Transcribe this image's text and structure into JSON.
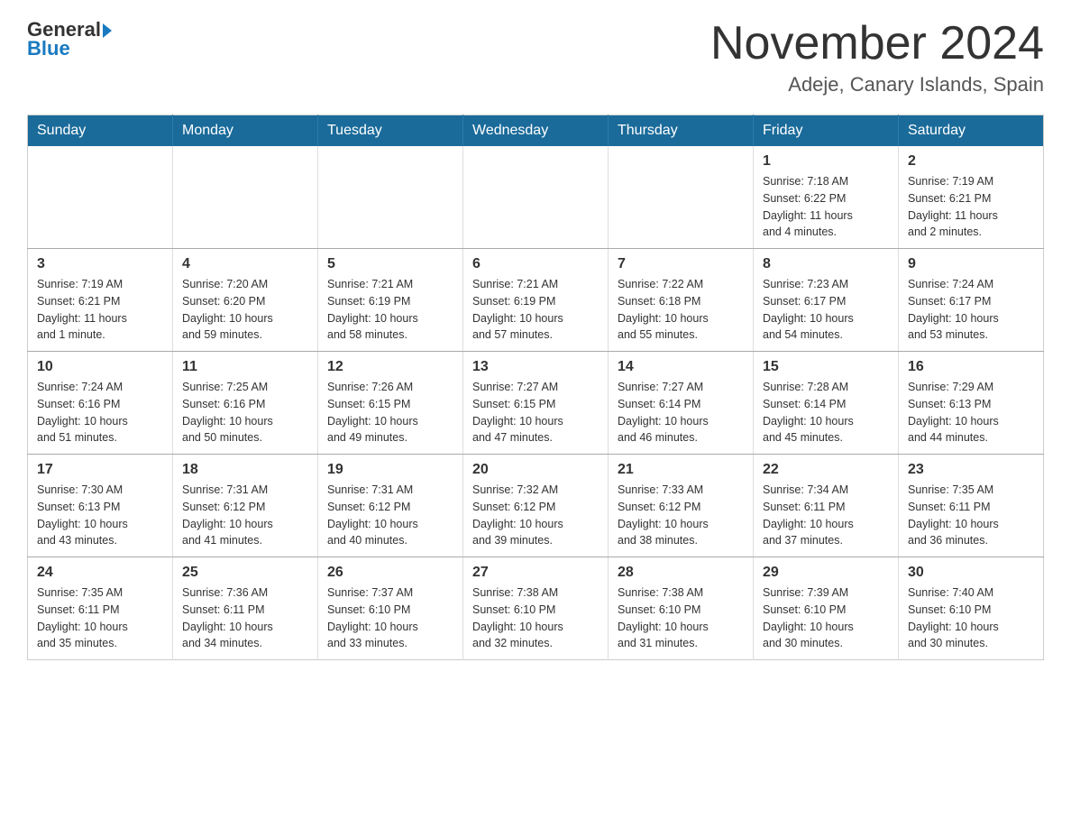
{
  "header": {
    "logo_text_general": "General",
    "logo_text_blue": "Blue",
    "month_title": "November 2024",
    "location": "Adeje, Canary Islands, Spain"
  },
  "weekdays": [
    "Sunday",
    "Monday",
    "Tuesday",
    "Wednesday",
    "Thursday",
    "Friday",
    "Saturday"
  ],
  "weeks": [
    [
      {
        "day": "",
        "info": ""
      },
      {
        "day": "",
        "info": ""
      },
      {
        "day": "",
        "info": ""
      },
      {
        "day": "",
        "info": ""
      },
      {
        "day": "",
        "info": ""
      },
      {
        "day": "1",
        "info": "Sunrise: 7:18 AM\nSunset: 6:22 PM\nDaylight: 11 hours\nand 4 minutes."
      },
      {
        "day": "2",
        "info": "Sunrise: 7:19 AM\nSunset: 6:21 PM\nDaylight: 11 hours\nand 2 minutes."
      }
    ],
    [
      {
        "day": "3",
        "info": "Sunrise: 7:19 AM\nSunset: 6:21 PM\nDaylight: 11 hours\nand 1 minute."
      },
      {
        "day": "4",
        "info": "Sunrise: 7:20 AM\nSunset: 6:20 PM\nDaylight: 10 hours\nand 59 minutes."
      },
      {
        "day": "5",
        "info": "Sunrise: 7:21 AM\nSunset: 6:19 PM\nDaylight: 10 hours\nand 58 minutes."
      },
      {
        "day": "6",
        "info": "Sunrise: 7:21 AM\nSunset: 6:19 PM\nDaylight: 10 hours\nand 57 minutes."
      },
      {
        "day": "7",
        "info": "Sunrise: 7:22 AM\nSunset: 6:18 PM\nDaylight: 10 hours\nand 55 minutes."
      },
      {
        "day": "8",
        "info": "Sunrise: 7:23 AM\nSunset: 6:17 PM\nDaylight: 10 hours\nand 54 minutes."
      },
      {
        "day": "9",
        "info": "Sunrise: 7:24 AM\nSunset: 6:17 PM\nDaylight: 10 hours\nand 53 minutes."
      }
    ],
    [
      {
        "day": "10",
        "info": "Sunrise: 7:24 AM\nSunset: 6:16 PM\nDaylight: 10 hours\nand 51 minutes."
      },
      {
        "day": "11",
        "info": "Sunrise: 7:25 AM\nSunset: 6:16 PM\nDaylight: 10 hours\nand 50 minutes."
      },
      {
        "day": "12",
        "info": "Sunrise: 7:26 AM\nSunset: 6:15 PM\nDaylight: 10 hours\nand 49 minutes."
      },
      {
        "day": "13",
        "info": "Sunrise: 7:27 AM\nSunset: 6:15 PM\nDaylight: 10 hours\nand 47 minutes."
      },
      {
        "day": "14",
        "info": "Sunrise: 7:27 AM\nSunset: 6:14 PM\nDaylight: 10 hours\nand 46 minutes."
      },
      {
        "day": "15",
        "info": "Sunrise: 7:28 AM\nSunset: 6:14 PM\nDaylight: 10 hours\nand 45 minutes."
      },
      {
        "day": "16",
        "info": "Sunrise: 7:29 AM\nSunset: 6:13 PM\nDaylight: 10 hours\nand 44 minutes."
      }
    ],
    [
      {
        "day": "17",
        "info": "Sunrise: 7:30 AM\nSunset: 6:13 PM\nDaylight: 10 hours\nand 43 minutes."
      },
      {
        "day": "18",
        "info": "Sunrise: 7:31 AM\nSunset: 6:12 PM\nDaylight: 10 hours\nand 41 minutes."
      },
      {
        "day": "19",
        "info": "Sunrise: 7:31 AM\nSunset: 6:12 PM\nDaylight: 10 hours\nand 40 minutes."
      },
      {
        "day": "20",
        "info": "Sunrise: 7:32 AM\nSunset: 6:12 PM\nDaylight: 10 hours\nand 39 minutes."
      },
      {
        "day": "21",
        "info": "Sunrise: 7:33 AM\nSunset: 6:12 PM\nDaylight: 10 hours\nand 38 minutes."
      },
      {
        "day": "22",
        "info": "Sunrise: 7:34 AM\nSunset: 6:11 PM\nDaylight: 10 hours\nand 37 minutes."
      },
      {
        "day": "23",
        "info": "Sunrise: 7:35 AM\nSunset: 6:11 PM\nDaylight: 10 hours\nand 36 minutes."
      }
    ],
    [
      {
        "day": "24",
        "info": "Sunrise: 7:35 AM\nSunset: 6:11 PM\nDaylight: 10 hours\nand 35 minutes."
      },
      {
        "day": "25",
        "info": "Sunrise: 7:36 AM\nSunset: 6:11 PM\nDaylight: 10 hours\nand 34 minutes."
      },
      {
        "day": "26",
        "info": "Sunrise: 7:37 AM\nSunset: 6:10 PM\nDaylight: 10 hours\nand 33 minutes."
      },
      {
        "day": "27",
        "info": "Sunrise: 7:38 AM\nSunset: 6:10 PM\nDaylight: 10 hours\nand 32 minutes."
      },
      {
        "day": "28",
        "info": "Sunrise: 7:38 AM\nSunset: 6:10 PM\nDaylight: 10 hours\nand 31 minutes."
      },
      {
        "day": "29",
        "info": "Sunrise: 7:39 AM\nSunset: 6:10 PM\nDaylight: 10 hours\nand 30 minutes."
      },
      {
        "day": "30",
        "info": "Sunrise: 7:40 AM\nSunset: 6:10 PM\nDaylight: 10 hours\nand 30 minutes."
      }
    ]
  ]
}
